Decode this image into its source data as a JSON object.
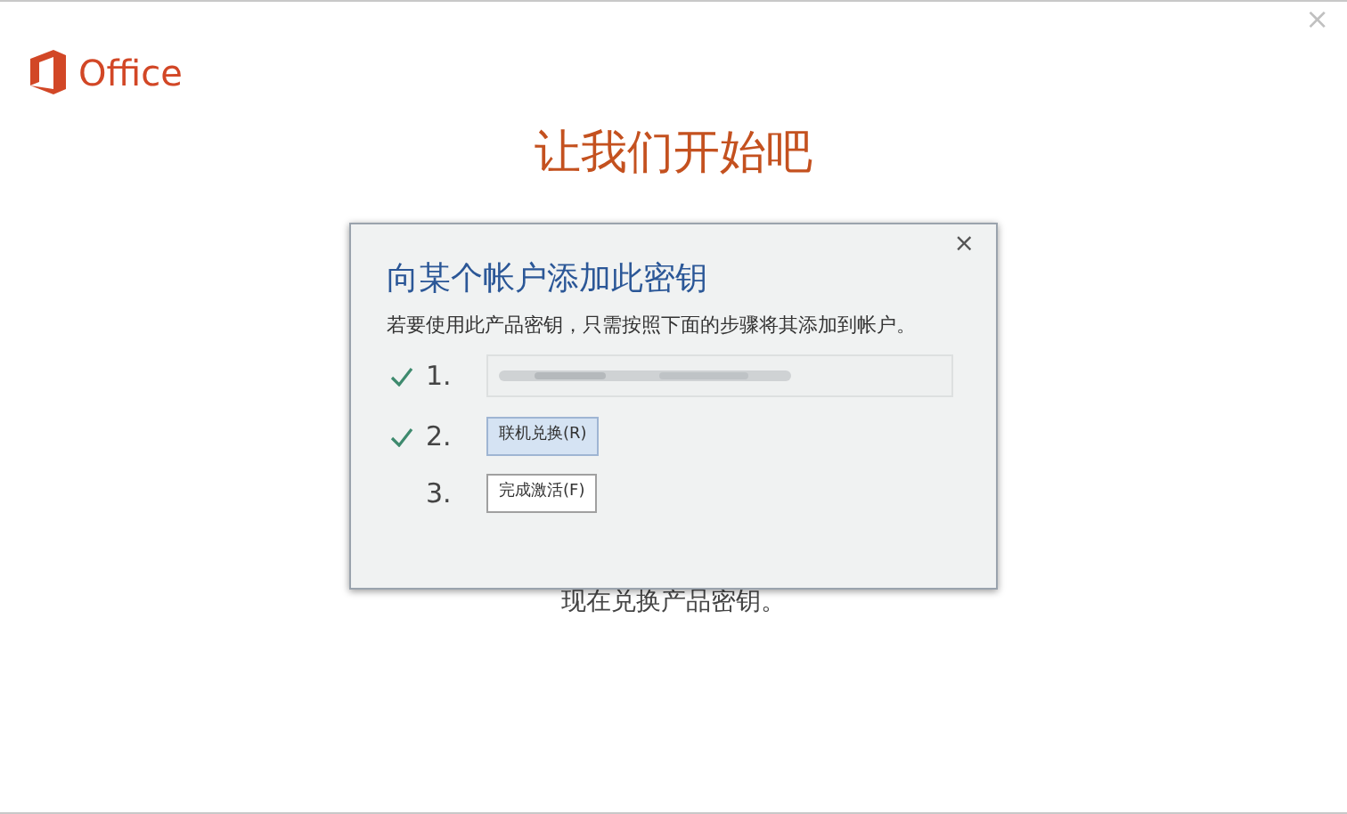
{
  "window": {
    "close": "×"
  },
  "logo": {
    "text": "Office"
  },
  "heading": "让我们开始吧",
  "background_text": "现在兑换产品密钥。",
  "dialog": {
    "close": "×",
    "title": "向某个帐户添加此密钥",
    "description": "若要使用此产品密钥，只需按照下面的步骤将其添加到帐户。",
    "steps": [
      {
        "number": "1.",
        "kind": "field",
        "checked": true
      },
      {
        "number": "2.",
        "kind": "button",
        "label": "联机兑换(R)",
        "checked": true,
        "selected": true
      },
      {
        "number": "3.",
        "kind": "button",
        "label": "完成激活(F)",
        "checked": false,
        "selected": false
      }
    ]
  }
}
